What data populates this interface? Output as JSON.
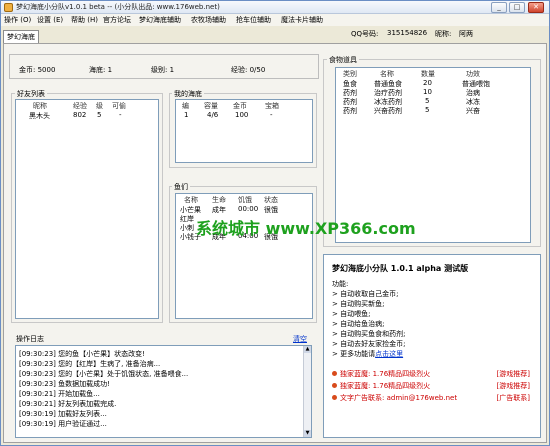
{
  "window": {
    "title": "梦幻海底小分队v1.0.1 beta -- (小分队出品: www.176web.net)",
    "minimize": "_",
    "maximize": "□",
    "close": "✕"
  },
  "menu": [
    "操作 (O)",
    "设置 (E)",
    "帮助 (H)",
    "官方论坛",
    "梦幻海底辅助",
    "农牧场辅助",
    "抢车位辅助",
    "魔法卡片辅助"
  ],
  "account": {
    "qq_label": "QQ号码:",
    "qq_value": "315154826",
    "nickname_label": "昵称:",
    "nickname_value": "阿两"
  },
  "tab": "梦幻海底",
  "stats": {
    "gold": "金币: 5000",
    "bottom": "海底: 1",
    "level": "级别: 1",
    "exp": "经验: 0/50"
  },
  "friends": {
    "title": "好友列表",
    "columns": [
      "昵称",
      "经验",
      "级",
      "可偷"
    ],
    "rows": [
      [
        "黑木头",
        "802",
        "5",
        "-"
      ]
    ]
  },
  "my_bottom": {
    "title": "我的海底",
    "columns": [
      "编",
      "容量",
      "金币",
      "宝箱"
    ],
    "rows": [
      [
        "1",
        "4/6",
        "100",
        "-"
      ]
    ]
  },
  "fish": {
    "title": "鱼们",
    "columns": [
      "名称",
      "生命",
      "饥饿",
      "状态"
    ],
    "rows": [
      [
        "小芒果",
        "成年",
        "00:00",
        "很饿"
      ],
      [
        "红岸",
        "",
        "",
        ""
      ],
      [
        "小刺",
        "",
        "",
        ""
      ],
      [
        "小钱子",
        "成年",
        "04:00",
        "很饿"
      ]
    ]
  },
  "food": {
    "title": "食物道具",
    "columns": [
      "类别",
      "名称",
      "数量",
      "功效"
    ],
    "rows": [
      [
        "鱼食",
        "普通鱼食",
        "20",
        "普通喂饱"
      ],
      [
        "药剂",
        "治疗药剂",
        "10",
        "治病"
      ],
      [
        "药剂",
        "冰冻药剂",
        "5",
        "冰冻"
      ],
      [
        "药剂",
        "兴奋药剂",
        "5",
        "兴奋"
      ]
    ]
  },
  "log": {
    "title": "操作日志",
    "clear": "清空",
    "lines": [
      "[09:30:23] 您的鱼【小芒果】状态改变!",
      "[09:30:23] 您的【红岸】生病了, 准备治病...",
      "[09:30:23] 您的【小芒果】处于饥饿状态, 准备喂食...",
      "[09:30:23] 鱼数据加载成功!",
      "[09:30:21] 开始加载鱼...",
      "[09:30:21] 好友列表加载完成.",
      "[09:30:19] 加载好友列表...",
      "[09:30:19] 用户验证通过..."
    ]
  },
  "info": {
    "title": "梦幻海底小分队   1.0.1 alpha 测试版",
    "features_label": "功能:",
    "features": [
      "> 自动收取自己金币;",
      "> 自动购买新鱼;",
      "> 自动喂鱼;",
      "> 自动给鱼治病;",
      "> 自动购买鱼食和药剂;",
      "> 自动去好友家捡金币;",
      "> 更多功能请"
    ],
    "more_link": "点击这里",
    "ads": [
      {
        "text": "独家蓝魔: 1.76精品四级烈火",
        "tag": "[游戏推荐]"
      },
      {
        "text": "独家蓝魔: 1.76精品四级烈火",
        "tag": "[游戏推荐]"
      },
      {
        "text": "文字广告联系: admin@176web.net",
        "tag": "[广告联系]"
      }
    ]
  },
  "watermark": "系统城市 www.XP366.com"
}
